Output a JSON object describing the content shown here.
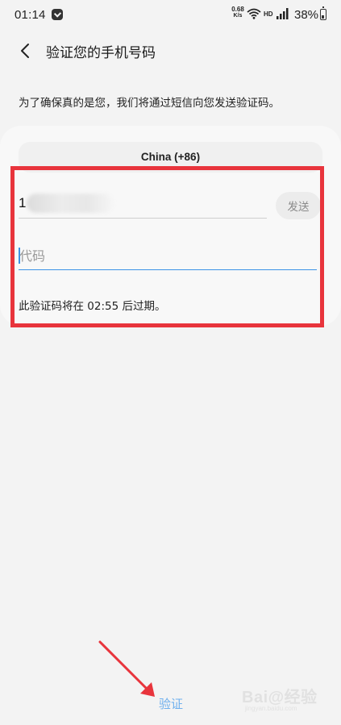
{
  "status_bar": {
    "time": "01:14",
    "net_speed_value": "0.68",
    "net_speed_unit": "K/s",
    "hd_label": "HD",
    "battery": "38%"
  },
  "header": {
    "title": "验证您的手机号码"
  },
  "description": "为了确保真的是您，我们将通过短信向您发送验证码。",
  "form": {
    "country": "China (+86)",
    "phone_visible_prefix": "1",
    "send_label": "发送",
    "code_placeholder": "代码",
    "expire_note": "此验证码将在 02:55 后过期。"
  },
  "footer": {
    "verify_label": "验证"
  },
  "watermark": {
    "brand": "Bai@经验",
    "sub": "jingyan.baidu.com"
  },
  "colors": {
    "accent": "#3b93e6",
    "highlight": "#e8343c",
    "verify": "#6fb0ee"
  }
}
